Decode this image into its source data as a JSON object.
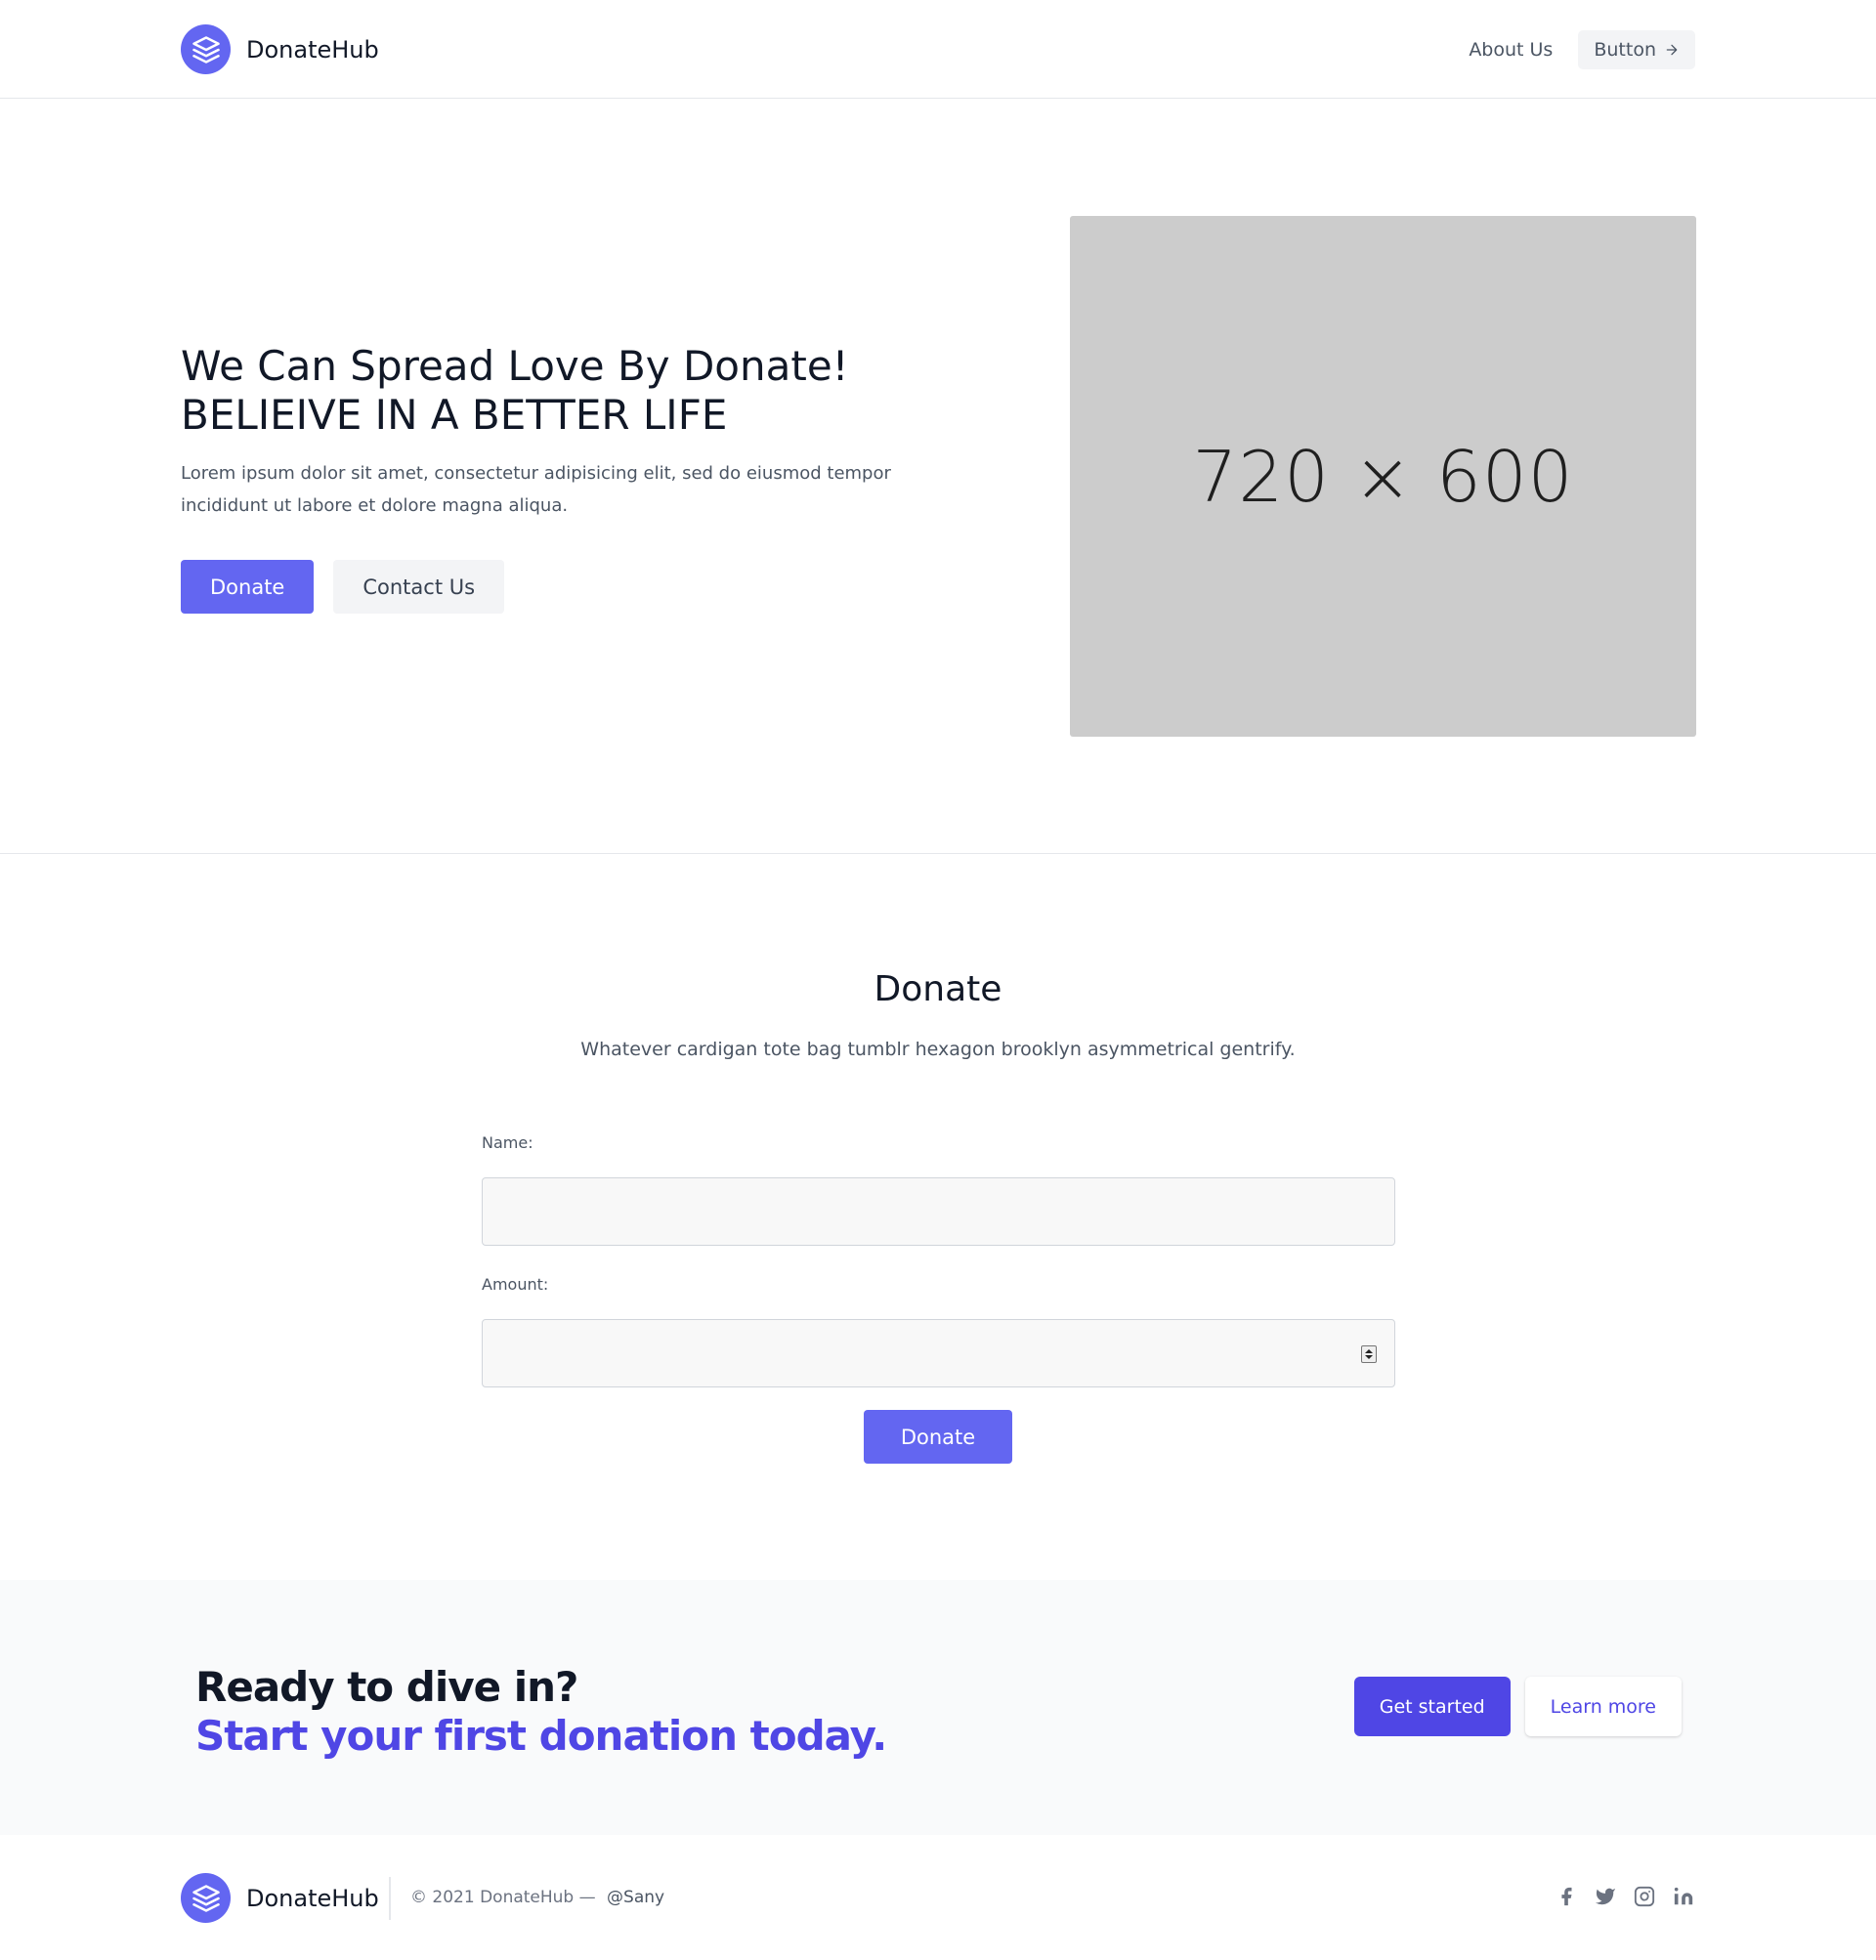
{
  "header": {
    "brand_name": "DonateHub",
    "nav": {
      "about_label": "About Us",
      "button_label": "Button"
    }
  },
  "hero": {
    "title_line1": "We Can Spread Love By Donate!",
    "title_line2": "BELIEIVE IN A BETTER LIFE",
    "description": "Lorem ipsum dolor sit amet, consectetur adipisicing elit, sed do eiusmod tempor incididunt ut labore et dolore magna aliqua.",
    "donate_label": "Donate",
    "contact_label": "Contact Us",
    "image_label": "720 × 600"
  },
  "donate_form": {
    "title": "Donate",
    "subtitle": "Whatever cardigan tote bag tumblr hexagon brooklyn asymmetrical gentrify.",
    "name_label": "Name:",
    "name_value": "",
    "amount_label": "Amount:",
    "amount_value": "",
    "submit_label": "Donate"
  },
  "cta": {
    "line1": "Ready to dive in?",
    "line2": "Start your first donation today.",
    "primary_label": "Get started",
    "secondary_label": "Learn more"
  },
  "footer": {
    "brand_name": "DonateHub",
    "copyright": "© 2021 DonateHub —",
    "handle": "@Sany",
    "social_icons": [
      "facebook-icon",
      "twitter-icon",
      "instagram-icon",
      "linkedin-icon"
    ]
  },
  "colors": {
    "accent": "#6366f1",
    "accent_dark": "#4f46e5",
    "placeholder_gray": "#cccccc"
  }
}
